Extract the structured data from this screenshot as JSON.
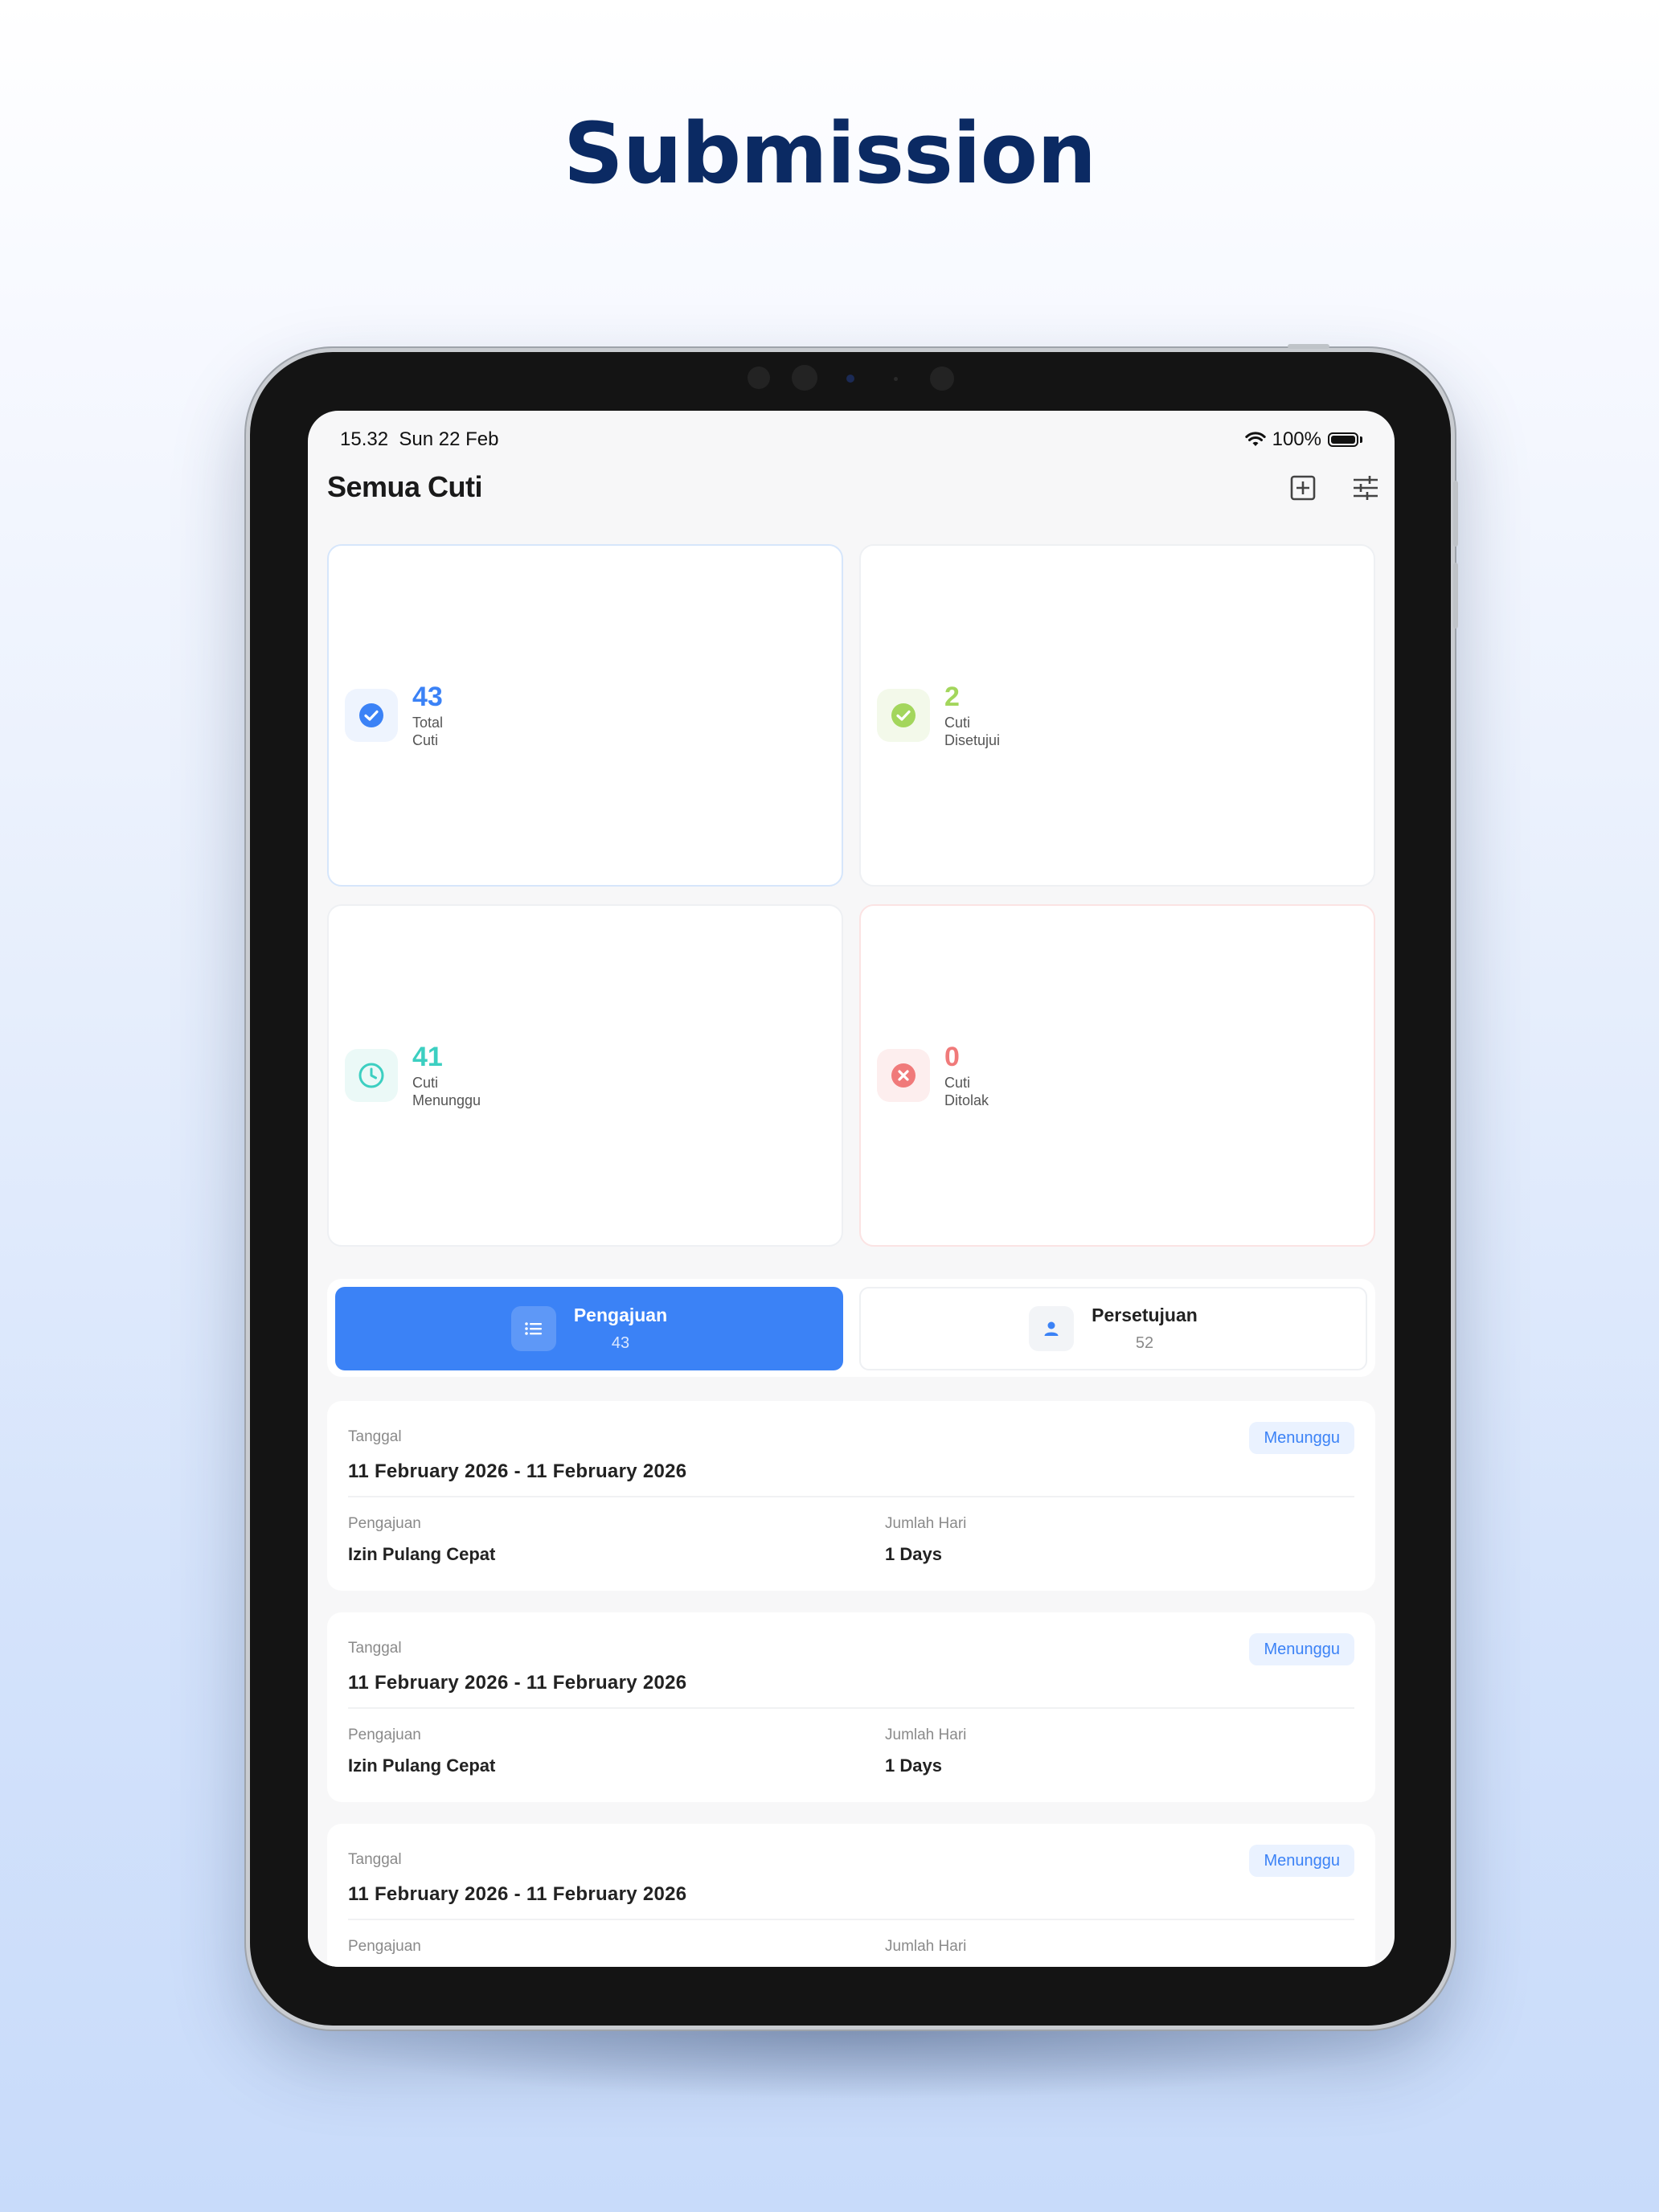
{
  "heading": "Submission",
  "status_bar": {
    "time": "15.32",
    "date": "Sun 22 Feb",
    "battery": "100%"
  },
  "app": {
    "title": "Semua Cuti",
    "add_icon": "add-square-icon",
    "filter_icon": "sliders-icon"
  },
  "colors": {
    "primary": "#3b82f6",
    "approved": "#a3d65c",
    "waiting": "#3ccfc1",
    "rejected": "#f07a7a",
    "heading": "#0b2a63"
  },
  "stats": [
    {
      "value": "43",
      "label_line1": "Total",
      "label_line2": "Cuti",
      "icon": "check-circle-icon"
    },
    {
      "value": "2",
      "label_line1": "Cuti",
      "label_line2": "Disetujui",
      "icon": "check-circle-icon"
    },
    {
      "value": "41",
      "label_line1": "Cuti",
      "label_line2": "Menunggu",
      "icon": "clock-icon"
    },
    {
      "value": "0",
      "label_line1": "Cuti",
      "label_line2": "Ditolak",
      "icon": "x-circle-icon"
    }
  ],
  "tabs": [
    {
      "label": "Pengajuan",
      "count": "43",
      "icon": "list-icon",
      "active": true
    },
    {
      "label": "Persetujuan",
      "count": "52",
      "icon": "person-icon",
      "active": false
    }
  ],
  "labels": {
    "date": "Tanggal",
    "type": "Pengajuan",
    "days": "Jumlah Hari"
  },
  "leaves": [
    {
      "date_range": "11 February 2026 - 11 February 2026",
      "status": "Menunggu",
      "type": "Izin Pulang Cepat",
      "days": "1 Days"
    },
    {
      "date_range": "11 February 2026 - 11 February 2026",
      "status": "Menunggu",
      "type": "Izin Pulang Cepat",
      "days": "1 Days"
    },
    {
      "date_range": "11 February 2026 - 11 February 2026",
      "status": "Menunggu"
    }
  ]
}
